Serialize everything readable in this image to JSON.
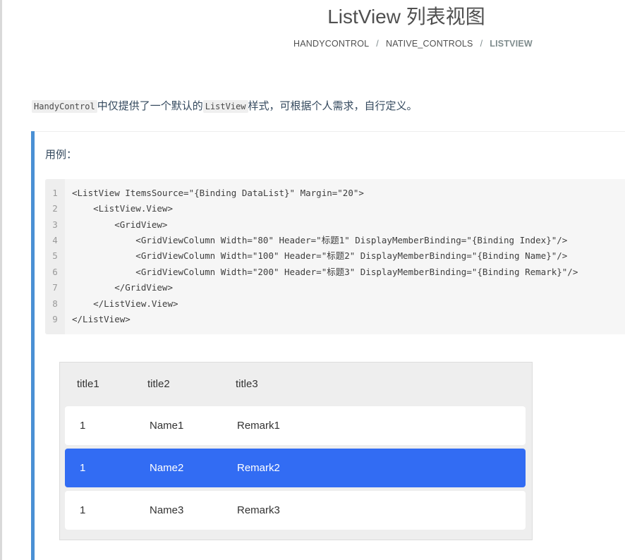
{
  "page": {
    "title": "ListView 列表视图"
  },
  "breadcrumb": {
    "items": [
      "HANDYCONTROL",
      "NATIVE_CONTROLS",
      "LISTVIEW"
    ],
    "separator": "/"
  },
  "intro": {
    "code1": "HandyControl",
    "text1": "中仅提供了一个默认的",
    "code2": "ListView",
    "text2": "样式，可根据个人需求，自行定义。"
  },
  "example": {
    "label": "用例："
  },
  "code": {
    "line_numbers": [
      "1",
      "2",
      "3",
      "4",
      "5",
      "6",
      "7",
      "8",
      "9"
    ],
    "lines": [
      "<ListView ItemsSource=\"{Binding DataList}\" Margin=\"20\">",
      "    <ListView.View>",
      "        <GridView>",
      "            <GridViewColumn Width=\"80\" Header=\"标题1\" DisplayMemberBinding=\"{Binding Index}\"/>",
      "            <GridViewColumn Width=\"100\" Header=\"标题2\" DisplayMemberBinding=\"{Binding Name}\"/>",
      "            <GridViewColumn Width=\"200\" Header=\"标题3\" DisplayMemberBinding=\"{Binding Remark}\"/>",
      "        </GridView>",
      "    </ListView.View>",
      "</ListView>"
    ]
  },
  "listview": {
    "headers": [
      "title1",
      "title2",
      "title3"
    ],
    "rows": [
      {
        "index": "1",
        "name": "Name1",
        "remark": "Remark1",
        "selected": false
      },
      {
        "index": "1",
        "name": "Name2",
        "remark": "Remark2",
        "selected": true
      },
      {
        "index": "1",
        "name": "Name3",
        "remark": "Remark3",
        "selected": false
      }
    ],
    "selected_color": "#326cf3"
  },
  "colors": {
    "accent_bar": "#4a90d4",
    "text": "#34495e"
  }
}
